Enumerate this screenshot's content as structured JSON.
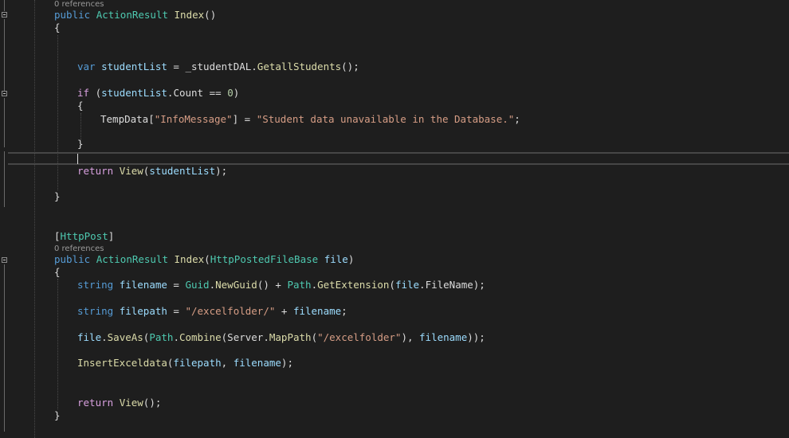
{
  "codelens": {
    "first": "0 references",
    "second": "0 references"
  },
  "code": {
    "l1": {
      "kw": "public",
      "ty": "ActionResult",
      "fn": "Index",
      "rest": "()"
    },
    "l2": {
      "brace": "{"
    },
    "l3": {
      "kw": "var",
      "loc": "studentList",
      "eq": " = _studentDAL.",
      "fn": "GetallStudents",
      "rest": "();"
    },
    "l4": {
      "kw": "if",
      "open": " (",
      "loc": "studentList",
      "dot": ".Count == ",
      "num": "0",
      "close": ")"
    },
    "l5": {
      "brace": "{"
    },
    "l6": {
      "pre": "TempData[",
      "str1": "\"InfoMessage\"",
      "mid": "] = ",
      "str2": "\"Student data unavailable in the Database.\"",
      "rest": ";"
    },
    "l7": {
      "brace": "}"
    },
    "l8": {
      "kw": "return",
      "fn": "View",
      "open": "(",
      "loc": "studentList",
      "rest": ");"
    },
    "l9": {
      "brace": "}"
    },
    "l10": {
      "open": "[",
      "ty": "HttpPost",
      "close": "]"
    },
    "l11": {
      "kw": "public",
      "ty": "ActionResult",
      "fn": "Index",
      "open": "(",
      "ty2": "HttpPostedFileBase",
      "loc": "file",
      "close": ")"
    },
    "l12": {
      "brace": "{"
    },
    "l13": {
      "kw": "string",
      "loc": "filename",
      "eq": " = ",
      "ty": "Guid",
      "fn": "NewGuid",
      "mid": "() + ",
      "ty2": "Path",
      "fn2": "GetExtension",
      "open": "(",
      "loc2": "file",
      "rest": ".FileName);"
    },
    "l14": {
      "kw": "string",
      "loc": "filepath",
      "eq": " = ",
      "str": "\"/excelfolder/\"",
      "mid": " + ",
      "loc2": "filename",
      "rest": ";"
    },
    "l15": {
      "loc": "file",
      "fn": "SaveAs",
      "ty": "Path",
      "fn2": "Combine",
      "pre2": "(Server.",
      "fn3": "MapPath",
      "str": "\"/excelfolder\"",
      "loc2": "filename",
      "rest": "));"
    },
    "l16": {
      "fn": "InsertExceldata",
      "open": "(",
      "loc": "filepath",
      "comma": ", ",
      "loc2": "filename",
      "rest": ");"
    },
    "l17": {
      "kw": "return",
      "fn": "View",
      "rest": "();"
    },
    "l18": {
      "brace": "}"
    }
  }
}
